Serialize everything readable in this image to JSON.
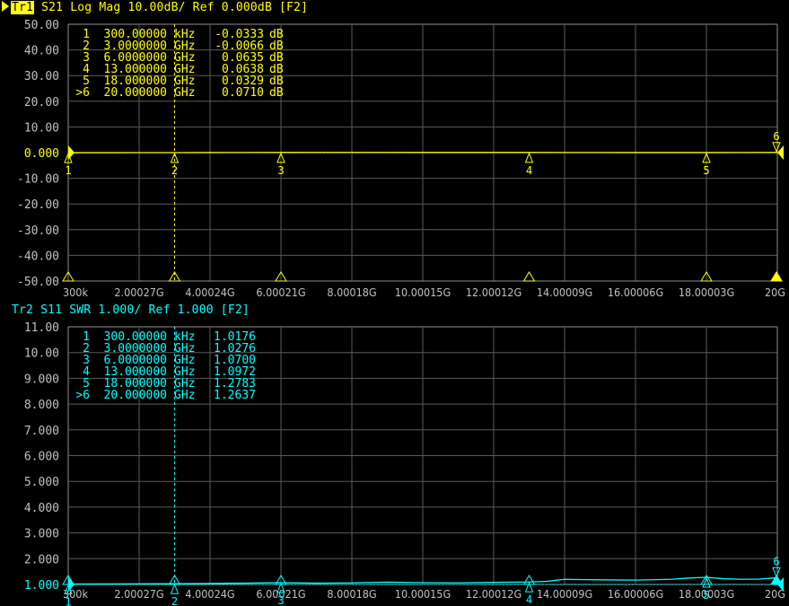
{
  "colors": {
    "trace1": "#ffff00",
    "trace2": "#00ffff",
    "grid": "#5a5a5a",
    "axis_text": "#c0c0c0",
    "background": "#000000"
  },
  "chart_data": [
    {
      "type": "line",
      "header": {
        "trace": "Tr1",
        "text": "S21 Log Mag 10.00dB/ Ref 0.000dB [F2]"
      },
      "ylim": [
        -50,
        50
      ],
      "y_ticks": [
        "50.00",
        "40.00",
        "30.00",
        "20.00",
        "10.00",
        "0.000",
        "-10.00",
        "-20.00",
        "-30.00",
        "-40.00",
        "-50.00"
      ],
      "ref_value": 0,
      "xlim_ghz": [
        0.0003,
        20
      ],
      "x_ticks": [
        "300k",
        "2.00027G",
        "4.00024G",
        "6.00021G",
        "8.00018G",
        "10.00015G",
        "12.00012G",
        "14.00009G",
        "16.00006G",
        "18.00003G",
        "20G"
      ],
      "grid": true,
      "series": [
        {
          "x": [
            0.0003,
            1,
            2,
            3,
            4,
            5,
            6,
            7,
            8,
            9,
            10,
            11,
            12,
            13,
            14,
            15,
            16,
            17,
            18,
            19,
            20
          ],
          "y": [
            -0.03,
            -0.02,
            -0.01,
            -0.01,
            0.02,
            0.05,
            0.06,
            0.08,
            0.1,
            0.09,
            0.07,
            0.06,
            0.06,
            0.06,
            0.05,
            0.04,
            0.03,
            0.03,
            0.03,
            0.05,
            0.07
          ]
        }
      ],
      "markers": [
        {
          "n": "1",
          "label": "1",
          "freq": "300.00000",
          "unit": "kHz",
          "x": 0.0003,
          "value": "-0.0333",
          "vunit": "dB"
        },
        {
          "n": "2",
          "label": "2",
          "freq": "3.0000000",
          "unit": "GHz",
          "x": 3,
          "value": "-0.0066",
          "vunit": "dB"
        },
        {
          "n": "3",
          "label": "3",
          "freq": "6.0000000",
          "unit": "GHz",
          "x": 6,
          "value": "0.0635",
          "vunit": "dB"
        },
        {
          "n": "4",
          "label": "4",
          "freq": "13.000000",
          "unit": "GHz",
          "x": 13,
          "value": "0.0638",
          "vunit": "dB"
        },
        {
          "n": "5",
          "label": "5",
          "freq": "18.000000",
          "unit": "GHz",
          "x": 18,
          "value": "0.0329",
          "vunit": "dB"
        },
        {
          "n": "6",
          "label": ">6",
          "freq": "20.000000",
          "unit": "GHz",
          "x": 20,
          "value": "0.0710",
          "vunit": "dB"
        }
      ]
    },
    {
      "type": "line",
      "header": {
        "trace": "Tr2",
        "text": "S11 SWR 1.000/ Ref 1.000 [F2]"
      },
      "ylim": [
        1,
        11
      ],
      "y_ticks": [
        "11.00",
        "10.00",
        "9.000",
        "8.000",
        "7.000",
        "6.000",
        "5.000",
        "4.000",
        "3.000",
        "2.000",
        "1.000"
      ],
      "ref_value": 1,
      "xlim_ghz": [
        0.0003,
        20
      ],
      "x_ticks": [
        "300k",
        "2.00027G",
        "4.00024G",
        "6.00021G",
        "8.00018G",
        "10.00015G",
        "12.00012G",
        "14.00009G",
        "16.00006G",
        "18.00003G",
        "20G"
      ],
      "grid": true,
      "series": [
        {
          "x": [
            0.0003,
            1,
            2,
            3,
            4,
            5,
            6,
            7,
            8,
            9,
            10,
            11,
            12,
            13,
            13.5,
            14,
            15,
            16,
            17,
            17.5,
            18,
            18.5,
            19,
            19.5,
            20
          ],
          "y": [
            1.018,
            1.02,
            1.025,
            1.028,
            1.04,
            1.05,
            1.07,
            1.05,
            1.06,
            1.09,
            1.07,
            1.06,
            1.08,
            1.097,
            1.12,
            1.2,
            1.18,
            1.17,
            1.2,
            1.25,
            1.278,
            1.22,
            1.2,
            1.21,
            1.264
          ]
        }
      ],
      "markers": [
        {
          "n": "1",
          "label": "1",
          "freq": "300.00000",
          "unit": "kHz",
          "x": 0.0003,
          "value": "1.0176",
          "vunit": ""
        },
        {
          "n": "2",
          "label": "2",
          "freq": "3.0000000",
          "unit": "GHz",
          "x": 3,
          "value": "1.0276",
          "vunit": ""
        },
        {
          "n": "3",
          "label": "3",
          "freq": "6.0000000",
          "unit": "GHz",
          "x": 6,
          "value": "1.0700",
          "vunit": ""
        },
        {
          "n": "4",
          "label": "4",
          "freq": "13.000000",
          "unit": "GHz",
          "x": 13,
          "value": "1.0972",
          "vunit": ""
        },
        {
          "n": "5",
          "label": "5",
          "freq": "18.000000",
          "unit": "GHz",
          "x": 18,
          "value": "1.2783",
          "vunit": ""
        },
        {
          "n": "6",
          "label": ">6",
          "freq": "20.000000",
          "unit": "GHz",
          "x": 20,
          "value": "1.2637",
          "vunit": ""
        }
      ]
    }
  ]
}
